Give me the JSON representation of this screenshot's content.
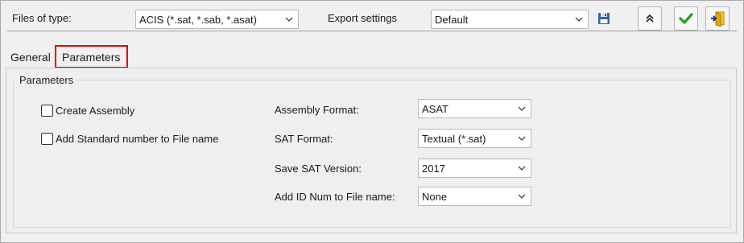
{
  "header": {
    "files_of_type_label": "Files of type:",
    "files_of_type_value": "ACIS (*.sat, *.sab, *.asat)",
    "export_settings_label": "Export settings",
    "export_settings_value": "Default"
  },
  "tabs": [
    {
      "label": "General",
      "active": false
    },
    {
      "label": "Parameters",
      "active": true
    }
  ],
  "group": {
    "title": "Parameters"
  },
  "checkboxes": [
    {
      "label": "Create Assembly",
      "checked": false
    },
    {
      "label": "Add Standard number to File name",
      "checked": false
    }
  ],
  "fields": [
    {
      "label": "Assembly  Format:",
      "value": "ASAT"
    },
    {
      "label": "SAT Format:",
      "value": "Textual (*.sat)"
    },
    {
      "label": "Save SAT Version:",
      "value": "2017"
    },
    {
      "label": "Add ID Num to File name:",
      "value": "None"
    }
  ],
  "icons": {
    "save": "floppy-disk-icon",
    "collapse": "double-chevron-up-icon",
    "ok": "checkmark-icon",
    "exit": "exit-icon"
  },
  "colors": {
    "accent_red": "#e30000",
    "ok_green": "#1fa01f",
    "save_blue": "#3a5fa8",
    "exit_yellow": "#e0a800"
  }
}
